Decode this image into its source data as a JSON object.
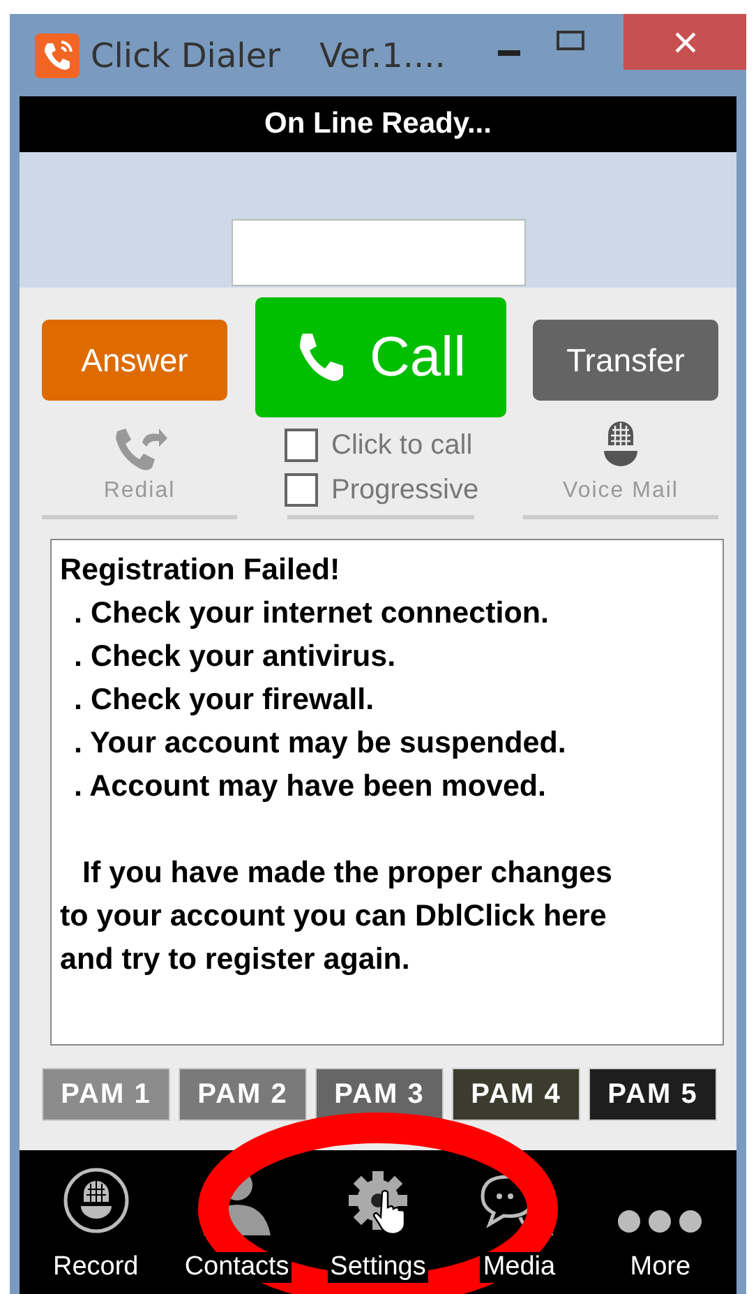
{
  "window": {
    "title": "Click Dialer",
    "version": "Ver.1...."
  },
  "status_bar": {
    "text": "On Line Ready..."
  },
  "main_buttons": [
    {
      "kind": "answer",
      "label": "Answer"
    },
    {
      "kind": "call",
      "label": "Call"
    },
    {
      "kind": "transfer",
      "label": "Transfer"
    }
  ],
  "quick_actions": [
    {
      "kind": "redial",
      "label": "Redial"
    },
    {
      "kind": "voicemail",
      "label": "Voice Mail"
    }
  ],
  "options": [
    {
      "label": "Click to call",
      "checked": false
    },
    {
      "label": "Progressive",
      "checked": false
    }
  ],
  "message": {
    "title": "Registration Failed!",
    "items": [
      ". Check your internet connection.",
      ". Check your antivirus.",
      ". Check your firewall.",
      ". Your account may be suspended.",
      ". Account may have been moved."
    ],
    "note": "If you have made the proper changes to your account you can DblClick here and try to register again."
  },
  "pam_buttons": [
    {
      "label": "PAM 1",
      "color": "#8c8c8c"
    },
    {
      "label": "PAM 2",
      "color": "#7a7a7a"
    },
    {
      "label": "PAM 3",
      "color": "#666666"
    },
    {
      "label": "PAM 4",
      "color": "#3b3b2e"
    },
    {
      "label": "PAM 5",
      "color": "#1e1e1e"
    }
  ],
  "nav": [
    {
      "kind": "record",
      "label": "Record",
      "highlighted": false
    },
    {
      "kind": "contacts",
      "label": "Contacts",
      "highlighted": false
    },
    {
      "kind": "settings",
      "label": "Settings",
      "highlighted": true
    },
    {
      "kind": "media",
      "label": "Media",
      "highlighted": false
    },
    {
      "kind": "more",
      "label": "More",
      "highlighted": false
    }
  ]
}
